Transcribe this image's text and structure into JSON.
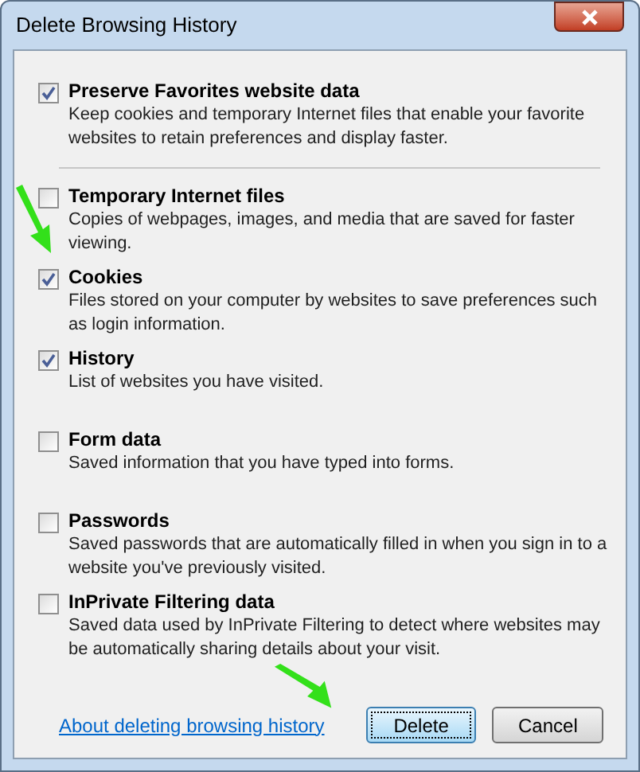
{
  "window": {
    "title": "Delete Browsing History"
  },
  "items": [
    {
      "label": "Preserve Favorites website data",
      "description": "Keep cookies and temporary Internet files that enable your favorite websites to retain preferences and display faster.",
      "checked": true
    },
    {
      "label": "Temporary Internet files",
      "description": "Copies of webpages, images, and media that are saved for faster viewing.",
      "checked": false
    },
    {
      "label": "Cookies",
      "description": "Files stored on your computer by websites to save preferences such as login information.",
      "checked": true
    },
    {
      "label": "History",
      "description": "List of websites you have visited.",
      "checked": true
    },
    {
      "label": "Form data",
      "description": "Saved information that you have typed into forms.",
      "checked": false
    },
    {
      "label": "Passwords",
      "description": "Saved passwords that are automatically filled in when you sign in to a website you've previously visited.",
      "checked": false
    },
    {
      "label": "InPrivate Filtering data",
      "description": "Saved data used by InPrivate Filtering to detect where websites may be automatically sharing details about your visit.",
      "checked": false
    }
  ],
  "link": "About deleting browsing history",
  "buttons": [
    {
      "label": "Delete",
      "kind": "default"
    },
    {
      "label": "Cancel",
      "kind": "normal"
    }
  ]
}
